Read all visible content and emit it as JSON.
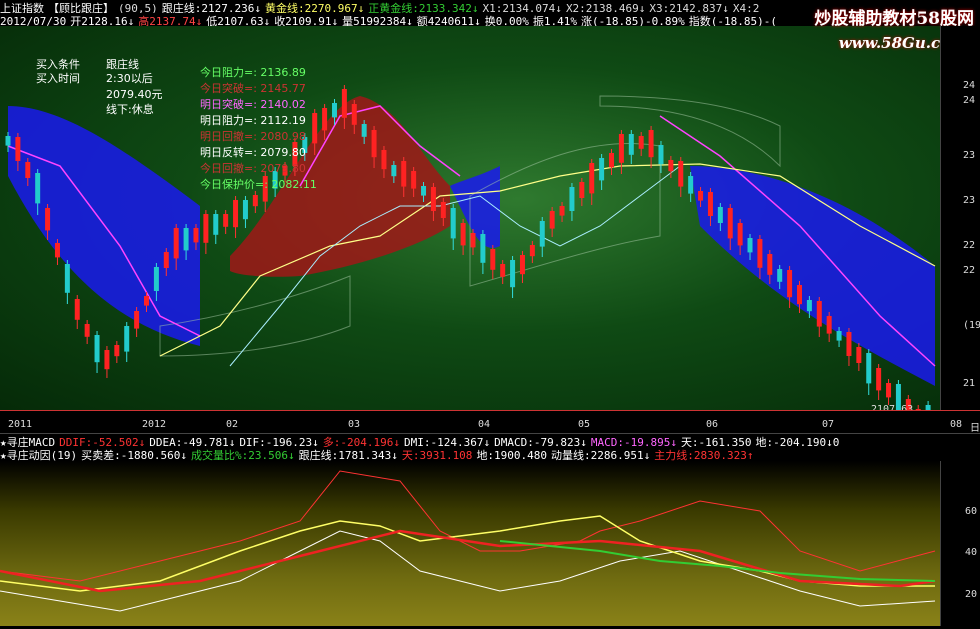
{
  "top1": [
    {
      "text": "上证指数",
      "color": "#ffffff"
    },
    {
      "text": "【顾比跟庄】",
      "color": "#ffffff"
    },
    {
      "text": "(90,5)",
      "color": "#dddddd"
    },
    {
      "text": "跟庄线:2127.236↓",
      "color": "#ffffff"
    },
    {
      "text": "黄金线:2270.967↓",
      "color": "#ffff66"
    },
    {
      "text": "正黄金线:2133.342↓",
      "color": "#33cc33"
    },
    {
      "text": "X1:2134.074↓",
      "color": "#dddddd"
    },
    {
      "text": "X2:2138.469↓",
      "color": "#dddddd"
    },
    {
      "text": "X3:2142.837↓",
      "color": "#dddddd"
    },
    {
      "text": "X4:2",
      "color": "#dddddd"
    }
  ],
  "top2": [
    {
      "text": "2012/07/30",
      "color": "#ffffff"
    },
    {
      "text": "开2128.16↓",
      "color": "#ffffff"
    },
    {
      "text": "高2137.74↓",
      "color": "#ff4444"
    },
    {
      "text": "低2107.63↓",
      "color": "#ffffff"
    },
    {
      "text": "收2109.91↓",
      "color": "#ffffff"
    },
    {
      "text": "量51992384↓",
      "color": "#ffffff"
    },
    {
      "text": "额4240611↓",
      "color": "#ffffff"
    },
    {
      "text": "换0.00%",
      "color": "#ffffff"
    },
    {
      "text": "振1.41%",
      "color": "#ffffff"
    },
    {
      "text": "涨(-18.85)-0.89%",
      "color": "#ffffff"
    },
    {
      "text": "指数(-18.85)-(",
      "color": "#ffffff"
    }
  ],
  "overlay_left": [
    {
      "text": "买入条件",
      "color": "#ffffff"
    },
    {
      "text": "跟庄线",
      "color": "#ffffff"
    },
    {
      "text": "买入时间",
      "color": "#ffffff"
    },
    {
      "text": "2:30以后",
      "color": "#ffffff"
    },
    {
      "text": "2079.40元",
      "color": "#ffffff"
    },
    {
      "text": "线下:休息",
      "color": "#ffffff"
    }
  ],
  "overlay_right": [
    {
      "text": "今日阻力=: 2136.89",
      "color": "#66ff66"
    },
    {
      "text": "今日突破=: 2145.77",
      "color": "#cc3333"
    },
    {
      "text": "明日突破=: 2140.02",
      "color": "#ff66ff"
    },
    {
      "text": "明日阻力=: 2112.19",
      "color": "#ffffff"
    },
    {
      "text": "明日回撤=: 2080.98",
      "color": "#cc3333"
    },
    {
      "text": "明日反转=: 2079.80",
      "color": "#ffffff"
    },
    {
      "text": "今日回撤=: 2079.80",
      "color": "#cc3333"
    },
    {
      "text": "今日保护价=: 2082.11",
      "color": "#66ff66"
    }
  ],
  "right_axis": [
    "24",
    "24",
    "23",
    "23",
    "22",
    "22",
    "(19",
    "21"
  ],
  "price_tag": "2107.63",
  "x_axis": [
    "2011",
    "2012",
    "02",
    "03",
    "04",
    "05",
    "06",
    "07",
    "08"
  ],
  "ind1": [
    {
      "text": "★寻庄MACD",
      "color": "#ffffff"
    },
    {
      "text": "DDIF:-52.502↓",
      "color": "#ff3333"
    },
    {
      "text": "DDEA:-49.781↓",
      "color": "#ffffff"
    },
    {
      "text": "DIF:-196.23↓",
      "color": "#ffffff"
    },
    {
      "text": "多:-204.196↓",
      "color": "#ff3333"
    },
    {
      "text": "DMI:-124.367↓",
      "color": "#ffffff"
    },
    {
      "text": "DMACD:-79.823↓",
      "color": "#ffffff"
    },
    {
      "text": "MACD:-19.895↓",
      "color": "#ff66ff"
    },
    {
      "text": "天:-161.350",
      "color": "#ffffff"
    },
    {
      "text": "地:-204.190↓0",
      "color": "#ffffff"
    }
  ],
  "ind2": [
    {
      "text": "★寻庄动因(19)",
      "color": "#ffffff"
    },
    {
      "text": "买卖差:-1880.560↓",
      "color": "#ffffff"
    },
    {
      "text": "成交量比%:23.506↓",
      "color": "#33cc33"
    },
    {
      "text": "跟庄线:1781.343↓",
      "color": "#ffffff"
    },
    {
      "text": "天:3931.108",
      "color": "#ff3333"
    },
    {
      "text": "地:1900.480",
      "color": "#ffffff"
    },
    {
      "text": "动量线:2286.951↓",
      "color": "#ffffff"
    },
    {
      "text": "主力线:2830.323↑",
      "color": "#ff3333"
    }
  ],
  "sub_axis": [
    "60",
    "40",
    "20"
  ],
  "watermark": "炒股辅助教材58股网",
  "watermark_url": "www.58Gu.com",
  "corner_label": "日"
}
